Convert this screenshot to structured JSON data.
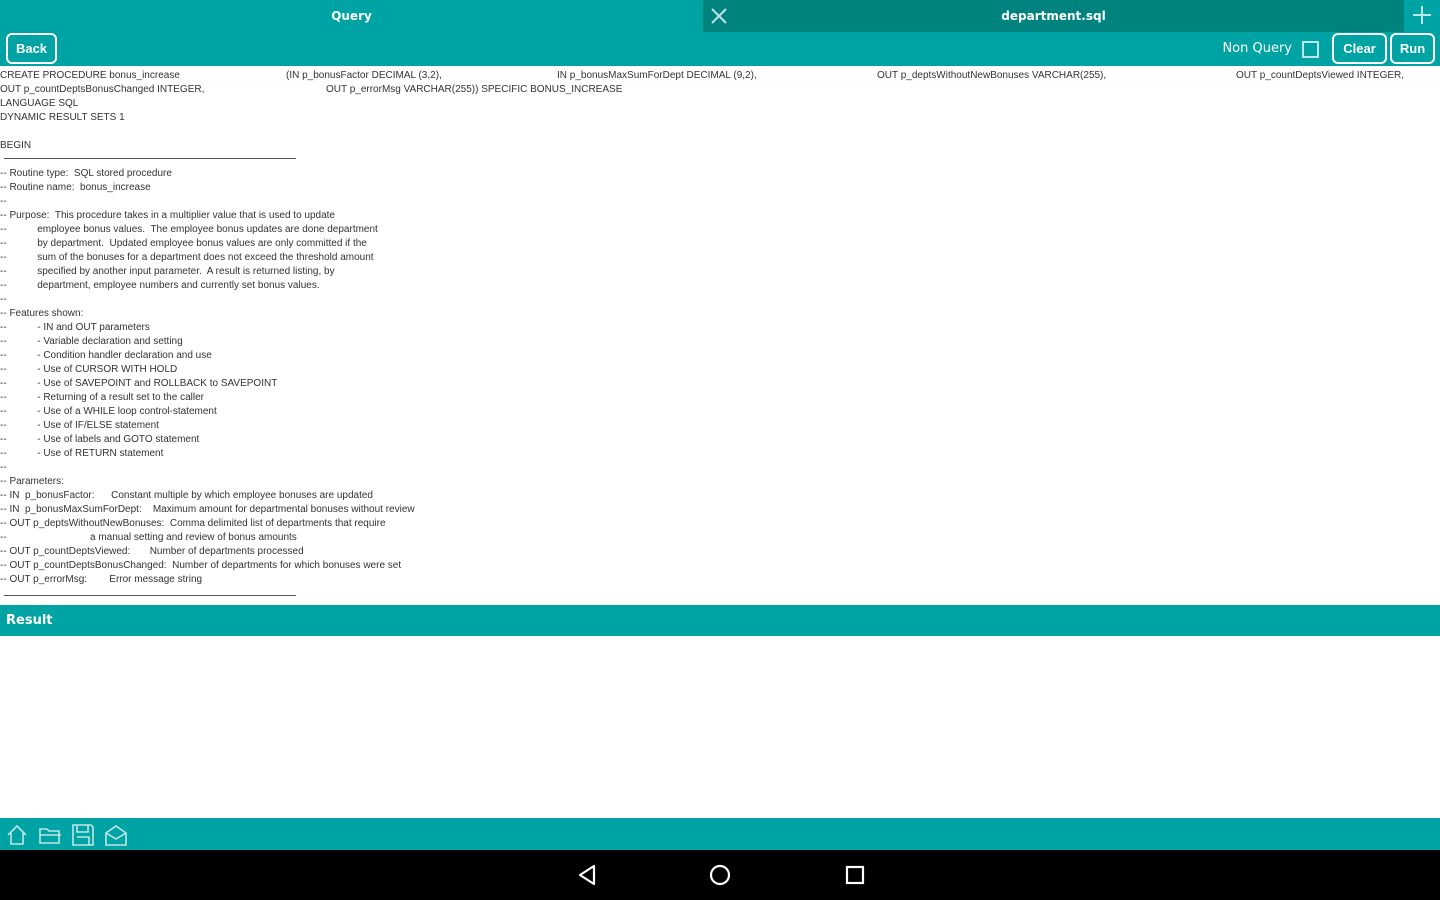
{
  "tabs": {
    "query_label": "Query",
    "file_label": "department.sql"
  },
  "toolbar": {
    "back_label": "Back",
    "non_query_label": "Non Query",
    "non_query_checked": false,
    "clear_label": "Clear",
    "run_label": "Run"
  },
  "editor": {
    "header": {
      "l1_a": "CREATE PROCEDURE bonus_increase",
      "l1_b": "(IN p_bonusFactor DECIMAL (3,2),",
      "l1_c": "IN p_bonusMaxSumForDept DECIMAL (9,2),",
      "l1_d": "OUT p_deptsWithoutNewBonuses VARCHAR(255),",
      "l1_e": "OUT p_countDeptsViewed INTEGER,",
      "l2_a": "OUT p_countDeptsBonusChanged INTEGER,",
      "l2_b": "OUT p_errorMsg VARCHAR(255)) SPECIFIC BONUS_INCREASE"
    },
    "lines": [
      "LANGUAGE SQL",
      "DYNAMIC RESULT SETS 1",
      "",
      "BEGIN",
      "",
      "-- Routine type:  SQL stored procedure",
      "-- Routine name:  bonus_increase",
      "--",
      "-- Purpose:  This procedure takes in a multiplier value that is used to update",
      "--           employee bonus values.  The employee bonus updates are done department",
      "--           by department.  Updated employee bonus values are only committed if the",
      "--           sum of the bonuses for a department does not exceed the threshold amount",
      "--           specified by another input parameter.  A result is returned listing, by",
      "--           department, employee numbers and currently set bonus values.",
      "--",
      "-- Features shown:",
      "--           - IN and OUT parameters",
      "--           - Variable declaration and setting",
      "--           - Condition handler declaration and use",
      "--           - Use of CURSOR WITH HOLD",
      "--           - Use of SAVEPOINT and ROLLBACK to SAVEPOINT",
      "--           - Returning of a result set to the caller",
      "--           - Use of a WHILE loop control-statement",
      "--           - Use of IF/ELSE statement",
      "--           - Use of labels and GOTO statement",
      "--           - Use of RETURN statement",
      "--",
      "-- Parameters:",
      "-- IN  p_bonusFactor:      Constant multiple by which employee bonuses are updated",
      "-- IN  p_bonusMaxSumForDept:    Maximum amount for departmental bonuses without review",
      "-- OUT p_deptsWithoutNewBonuses:  Comma delimited list of departments that require",
      "--                              a manual setting and review of bonus amounts",
      "-- OUT p_countDeptsViewed:       Number of departments processed",
      "-- OUT p_countDeptsBonusChanged:  Number of departments for which bonuses were set",
      "-- OUT p_errorMsg:        Error message string"
    ]
  },
  "result": {
    "label": "Result"
  },
  "bottom_icons": [
    "home-icon",
    "folder-open-icon",
    "save-icon",
    "mail-icon"
  ],
  "nav_icons": [
    "back-triangle-icon",
    "home-circle-icon",
    "recents-square-icon"
  ],
  "colors": {
    "teal": "#00a3a3",
    "teal_dark": "#00837f",
    "navbar": "#000000",
    "code_text": "#333333"
  }
}
